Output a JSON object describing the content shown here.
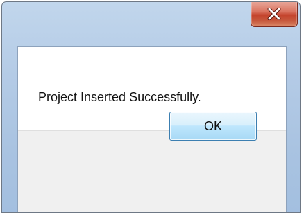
{
  "window": {
    "title": ""
  },
  "titlebar": {
    "close_icon": "close-icon",
    "close_button_color": "#c7503a"
  },
  "dialog": {
    "message": "Project Inserted Successfully.",
    "ok_label": "OK"
  },
  "colors": {
    "frame": "#a9c3e1",
    "content_bg": "#ffffff",
    "footer_bg": "#f0f0f0",
    "button_border": "#3c7fb1"
  }
}
